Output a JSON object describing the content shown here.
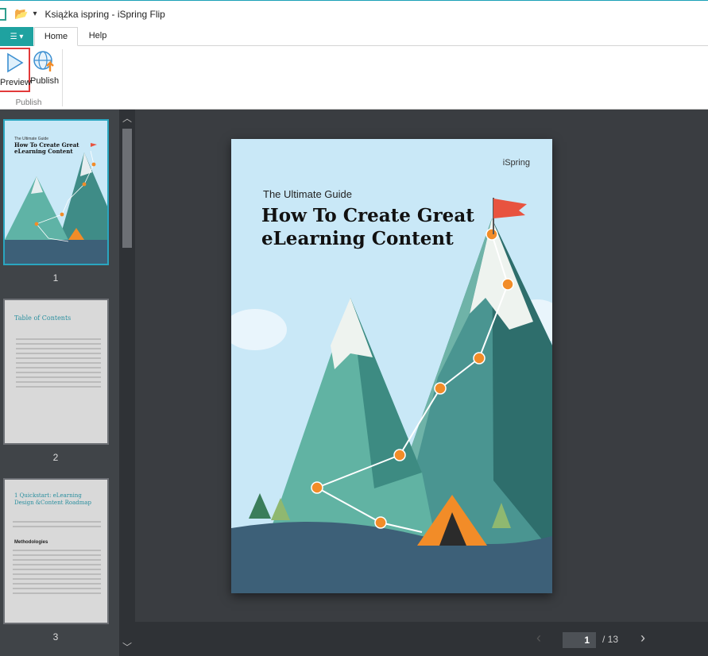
{
  "window": {
    "title": "Książka ispring - iSpring Flip"
  },
  "ribbon": {
    "file_label": "☰ ▾",
    "tabs": [
      {
        "label": "Home"
      },
      {
        "label": "Help"
      }
    ],
    "buttons": {
      "preview": "Preview",
      "publish": "Publish"
    },
    "group_label": "Publish"
  },
  "thumbnails": [
    {
      "number": "1",
      "kicker": "The Ultimate Guide",
      "title": "How To Create Great eLearning Content"
    },
    {
      "number": "2",
      "title": "Table of Contents"
    },
    {
      "number": "3",
      "title": "1 Quickstart: eLearning Design &Content Roadmap",
      "heading": "Methodologies"
    }
  ],
  "page": {
    "brand": "iSpring",
    "kicker": "The Ultimate Guide",
    "title": "How To Create Great eLearning Content"
  },
  "nav": {
    "current_page": "1",
    "total": "/ 13"
  },
  "colors": {
    "accent": "#1fa2a0",
    "flag": "#e8533f",
    "marker": "#f28c28",
    "sky": "#c9e8f7"
  }
}
